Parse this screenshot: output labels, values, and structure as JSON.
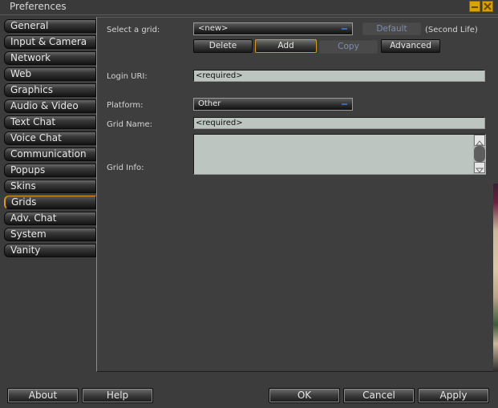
{
  "window": {
    "title": "Preferences",
    "minimize_icon": "minimize-icon",
    "close_icon": "close-icon",
    "accent_color": "#d9a300"
  },
  "sidebar": {
    "active": "Grids",
    "items": [
      {
        "label": "General"
      },
      {
        "label": "Input & Camera"
      },
      {
        "label": "Network"
      },
      {
        "label": "Web"
      },
      {
        "label": "Graphics"
      },
      {
        "label": "Audio & Video"
      },
      {
        "label": "Text Chat"
      },
      {
        "label": "Voice Chat"
      },
      {
        "label": "Communication"
      },
      {
        "label": "Popups"
      },
      {
        "label": "Skins"
      },
      {
        "label": "Grids"
      },
      {
        "label": "Adv. Chat"
      },
      {
        "label": "System"
      },
      {
        "label": "Vanity"
      }
    ]
  },
  "grids": {
    "select_grid_label": "Select a grid:",
    "select_grid_value": "<new>",
    "default_button": "Default",
    "default_grid_note": "(Second Life)",
    "delete_button": "Delete",
    "add_button": "Add",
    "copy_button": "Copy",
    "advanced_button": "Advanced",
    "login_uri_label": "Login URI:",
    "login_uri_value": "<required>",
    "platform_label": "Platform:",
    "platform_value": "Other",
    "grid_name_label": "Grid Name:",
    "grid_name_value": "<required>",
    "grid_info_label": "Grid Info:",
    "grid_info_value": ""
  },
  "footer": {
    "about_button": "About",
    "help_button": "Help",
    "ok_button": "OK",
    "cancel_button": "Cancel",
    "apply_button": "Apply"
  }
}
